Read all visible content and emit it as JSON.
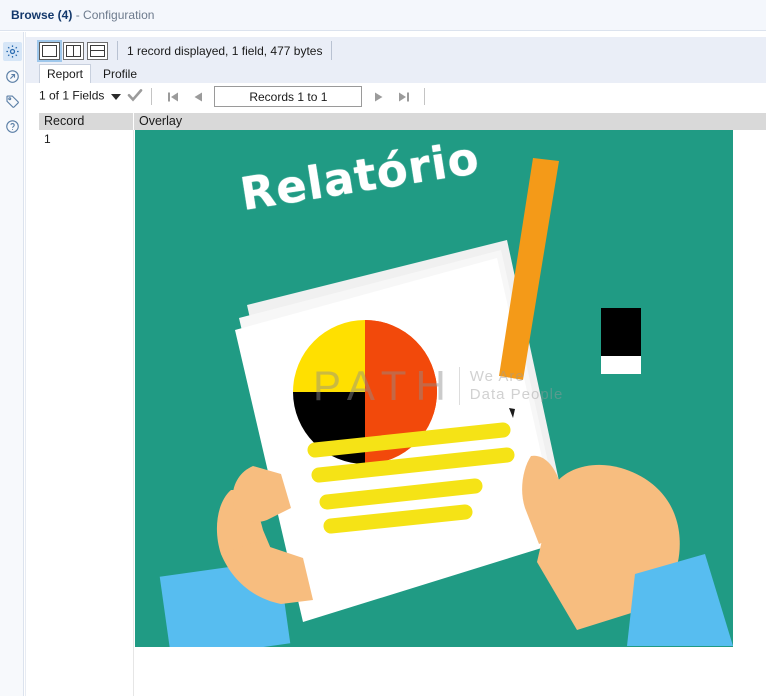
{
  "window": {
    "title_main": "Browse (4)",
    "title_sub": "- Configuration"
  },
  "rail": {
    "items": [
      {
        "name": "gear-icon",
        "label": "Configuration",
        "active": true
      },
      {
        "name": "export-icon",
        "label": "Export",
        "active": false
      },
      {
        "name": "tag-icon",
        "label": "Annotation",
        "active": false
      },
      {
        "name": "help-icon",
        "label": "Help",
        "active": false
      }
    ]
  },
  "toolbar": {
    "layout_single_label": "Single pane layout",
    "layout_vertical_label": "Vertical split layout",
    "layout_horizontal_label": "Horizontal split layout",
    "status": "1 record displayed, 1 field, 477 bytes"
  },
  "tabs": [
    {
      "label": "Report",
      "active": true
    },
    {
      "label": "Profile",
      "active": false
    }
  ],
  "navbar": {
    "fields_label": "1 of 1 Fields",
    "records_label": "Records 1 to 1",
    "first_label": "First record",
    "prev_label": "Previous record",
    "next_label": "Next record",
    "last_label": "Last record"
  },
  "grid": {
    "columns": [
      "Record",
      "Overlay"
    ],
    "rows": [
      {
        "record": "1",
        "overlay": "report-illustration"
      }
    ]
  },
  "overlay_image": {
    "heading": "Relatório",
    "watermark_brand": "PATH",
    "watermark_line1": "We Are",
    "watermark_line2": "Data People",
    "colors": {
      "background": "#209b84",
      "paper": "#ffffff",
      "pie_yellow": "#ffe000",
      "pie_orange": "#f2490b",
      "pie_black": "#000000",
      "highlight": "#f5e316",
      "pencil": "#f49a18",
      "skin": "#f7bd7f",
      "sleeve": "#57bdf0",
      "eraser": "#000000"
    },
    "pie_chart": {
      "type": "pie",
      "title": "Relatório",
      "categories": [
        "Orange",
        "Yellow",
        "Black"
      ],
      "values": [
        50,
        25,
        25
      ],
      "colors": [
        "#f2490b",
        "#ffe000",
        "#000000"
      ],
      "legend": "none"
    },
    "highlight_line_count": 4
  }
}
